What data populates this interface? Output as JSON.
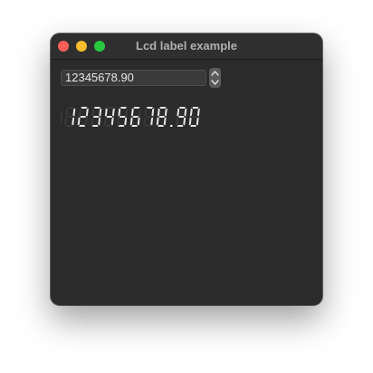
{
  "window": {
    "title": "Lcd label example",
    "controls": {
      "close": "#ff5f57",
      "minimize": "#febc2e",
      "zoom": "#28c840"
    }
  },
  "spinbox": {
    "value": "12345678.90",
    "up_icon": "chevron-up-icon",
    "down_icon": "chevron-down-icon"
  },
  "lcd": {
    "value": "12345678.90",
    "segment_on_color": "#e8e8e8",
    "segment_off_color": "#3a3a3a"
  }
}
